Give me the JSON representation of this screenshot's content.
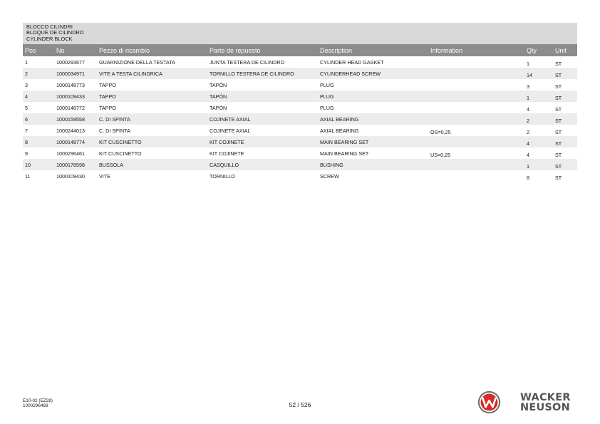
{
  "header": {
    "title_it": "BLOCCO CILINDRI",
    "title_es": "BLOQUE DE CILINDRO",
    "title_en": "CYLINDER BLOCK"
  },
  "table": {
    "columns": {
      "pos": "Pos",
      "no": "No",
      "it": "Pezzo di ricambio",
      "es": "Parte de repuesto",
      "en": "Description",
      "info": "Information",
      "qty": "Qty",
      "unit": "Unit"
    },
    "rows": [
      {
        "pos": "1",
        "no": "1000293677",
        "it": "GUARNIZIONE DELLA TESTATA",
        "es": "JUNTA TESTERA DE CILINDRO",
        "en": "CYLINDER HEAD GASKET",
        "info": "",
        "qty": "1",
        "unit": "ST"
      },
      {
        "pos": "2",
        "no": "1000034971",
        "it": "VITE A TESTA CILINDRICA",
        "es": "TORNILLO TESTERA DE CILINDRO",
        "en": "CYLINDERHEAD SCREW",
        "info": "",
        "qty": "14",
        "unit": "ST"
      },
      {
        "pos": "3",
        "no": "1000148773",
        "it": "TAPPO",
        "es": "TAPÓN",
        "en": "PLUG",
        "info": "",
        "qty": "3",
        "unit": "ST"
      },
      {
        "pos": "4",
        "no": "1000109433",
        "it": "TAPPO",
        "es": "TAPÓN",
        "en": "PLUG",
        "info": "",
        "qty": "1",
        "unit": "ST"
      },
      {
        "pos": "5",
        "no": "1000148772",
        "it": "TAPPO",
        "es": "TAPÓN",
        "en": "PLUG",
        "info": "",
        "qty": "4",
        "unit": "ST"
      },
      {
        "pos": "6",
        "no": "1000159558",
        "it": "C. DI SPINTA",
        "es": "COJINETE AXIAL",
        "en": "AXIAL BEARING",
        "info": "",
        "qty": "2",
        "unit": "ST"
      },
      {
        "pos": "7",
        "no": "1000244013",
        "it": "C. DI SPINTA",
        "es": "COJINETE AXIAL",
        "en": "AXIAL BEARING",
        "info": "OS=0,25",
        "qty": "2",
        "unit": "ST"
      },
      {
        "pos": "8",
        "no": "1000148774",
        "it": "KIT CUSCINETTO",
        "es": "KIT COJINETE",
        "en": "MAIN BEARING SET",
        "info": "",
        "qty": "4",
        "unit": "ST"
      },
      {
        "pos": "9",
        "no": "1000296461",
        "it": "KIT CUSCINETTO",
        "es": "KIT COJINETE",
        "en": "MAIN BEARING SET",
        "info": "US=0,25",
        "qty": "4",
        "unit": "ST"
      },
      {
        "pos": "10",
        "no": "1000178598",
        "it": "BUSSOLA",
        "es": "CASQUILLO",
        "en": "BUSHING",
        "info": "",
        "qty": "1",
        "unit": "ST"
      },
      {
        "pos": "11",
        "no": "1000109430",
        "it": "VITE",
        "es": "TORNILLO",
        "en": "SCREW",
        "info": "",
        "qty": "8",
        "unit": "ST"
      }
    ]
  },
  "footer": {
    "model": "E10-02 (EZ28)",
    "doc_number": "1000296469",
    "page": "52 / 526"
  },
  "logo": {
    "line1": "WACKER",
    "line2": "NEUSON",
    "brand_color": "#d72a2a",
    "text_color": "#555555"
  },
  "colors": {
    "header_band": "#d9d9d9",
    "table_header": "#8c8c8c",
    "row_stripe": "#ececec"
  }
}
